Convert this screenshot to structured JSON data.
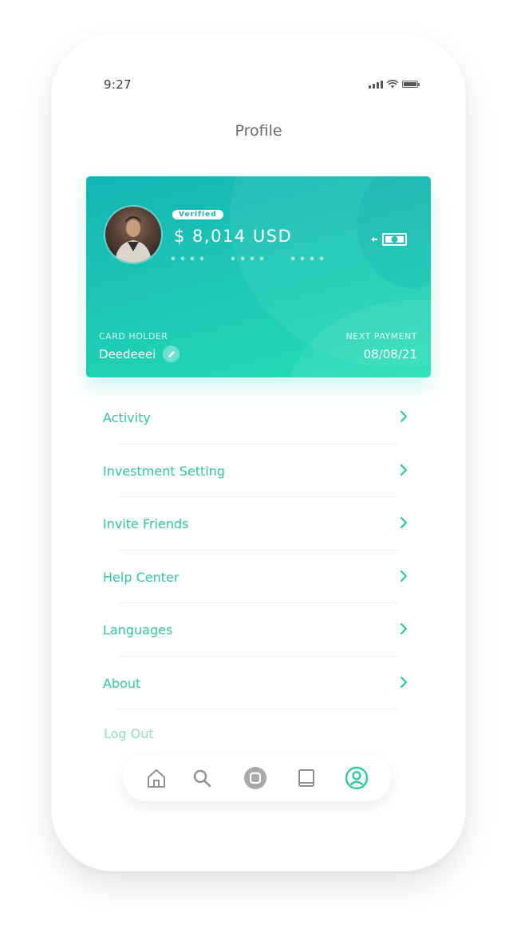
{
  "status_bar": {
    "time": "9:27",
    "icons": [
      "signal-icon",
      "wifi-icon",
      "battery-icon"
    ]
  },
  "header": {
    "title": "Profile"
  },
  "card": {
    "verified_label": "Verified",
    "balance": "$ 8,014 USD",
    "masked_groups": [
      "****",
      "****",
      "****"
    ],
    "card_holder_label": "CARD HOLDER",
    "card_holder_name": "Deedeeei",
    "next_payment_label": "NEXT PAYMENT",
    "next_payment_date": "08/08/21",
    "gradient_start": "#14b4b6",
    "gradient_end": "#23dfb4"
  },
  "menu": {
    "items": [
      {
        "label": "Activity"
      },
      {
        "label": "Investment Setting"
      },
      {
        "label": "Invite Friends"
      },
      {
        "label": "Help Center"
      },
      {
        "label": "Languages"
      },
      {
        "label": "About"
      }
    ],
    "logout_label": "Log Out",
    "accent_color": "#2fc79f"
  },
  "tabbar": {
    "tabs": [
      {
        "icon": "home-icon",
        "active": false
      },
      {
        "icon": "search-icon",
        "active": false
      },
      {
        "icon": "center-button-icon",
        "active": false
      },
      {
        "icon": "book-icon",
        "active": false
      },
      {
        "icon": "profile-icon",
        "active": true
      }
    ]
  }
}
